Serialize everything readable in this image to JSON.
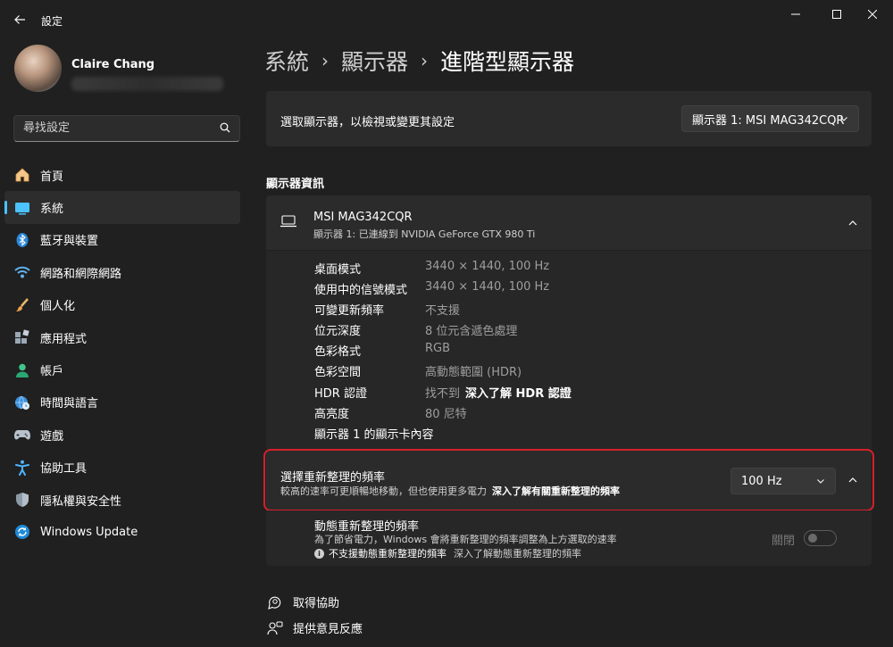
{
  "window": {
    "app_title": "設定",
    "minimize_glyph": "─",
    "maximize_glyph": "☐",
    "close_glyph": "✕"
  },
  "user": {
    "name": "Claire Chang"
  },
  "search": {
    "placeholder": "尋找設定"
  },
  "sidebar": {
    "items": [
      {
        "label": "首頁",
        "icon": "home-icon"
      },
      {
        "label": "系統",
        "icon": "system-icon",
        "active": true
      },
      {
        "label": "藍牙與裝置",
        "icon": "bluetooth-icon"
      },
      {
        "label": "網路和網際網路",
        "icon": "wifi-icon"
      },
      {
        "label": "個人化",
        "icon": "brush-icon"
      },
      {
        "label": "應用程式",
        "icon": "apps-icon"
      },
      {
        "label": "帳戶",
        "icon": "account-icon"
      },
      {
        "label": "時間與語言",
        "icon": "globe-clock-icon"
      },
      {
        "label": "遊戲",
        "icon": "gamepad-icon"
      },
      {
        "label": "協助工具",
        "icon": "accessibility-icon"
      },
      {
        "label": "隱私權與安全性",
        "icon": "shield-icon"
      },
      {
        "label": "Windows Update",
        "icon": "update-icon"
      }
    ]
  },
  "breadcrumb": {
    "level1": "系統",
    "level2": "顯示器",
    "current": "進階型顯示器",
    "separator": "›"
  },
  "select_display": {
    "label": "選取顯示器，以檢視或變更其設定",
    "selected": "顯示器 1: MSI MAG342CQR"
  },
  "display_info": {
    "section_title": "顯示器資訊",
    "monitor_name": "MSI MAG342CQR",
    "monitor_subtitle": "顯示器 1: 已連線到 NVIDIA GeForce GTX 980 Ti",
    "rows": [
      {
        "key": "桌面模式",
        "value": "3440 × 1440, 100 Hz"
      },
      {
        "key": "使用中的信號模式",
        "value": "3440 × 1440, 100 Hz"
      },
      {
        "key": "可變更新頻率",
        "value": "不支援"
      },
      {
        "key": "位元深度",
        "value": "8 位元含遞色處理"
      },
      {
        "key": "色彩格式",
        "value": "RGB"
      },
      {
        "key": "色彩空間",
        "value": "高動態範圍 (HDR)"
      },
      {
        "key": "HDR 認證",
        "value": "找不到",
        "link": "深入了解 HDR 認證"
      },
      {
        "key": "高亮度",
        "value": "80 尼特"
      },
      {
        "key": "顯示器 1 的顯示卡內容",
        "value": ""
      }
    ]
  },
  "refresh_rate": {
    "title": "選擇重新整理的頻率",
    "subtitle": "較高的速率可更順暢地移動，但也使用更多電力",
    "link": "深入了解有關重新整理的頻率",
    "selected": "100 Hz"
  },
  "dynamic_refresh": {
    "title": "動態重新整理的頻率",
    "subtitle": "為了節省電力，Windows 會將重新整理的頻率調整為上方選取的速率",
    "note": "不支援動態重新整理的頻率",
    "note_link": "深入了解動態重新整理的頻率",
    "toggle_label": "關閉",
    "toggle_on": false
  },
  "footer": {
    "help": "取得協助",
    "feedback": "提供意見反應"
  },
  "colors": {
    "accent": "#4cc2ff",
    "highlight_border": "#d6202a",
    "background": "#202020",
    "card": "#2b2b2b"
  }
}
